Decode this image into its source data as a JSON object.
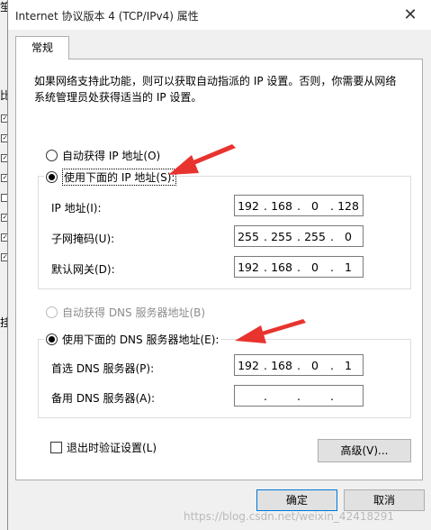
{
  "window": {
    "title": "Internet 协议版本 4 (TCP/IPv4) 属性",
    "close_glyph": "✕"
  },
  "background_window": {
    "chars": [
      "笙",
      "比",
      "挂"
    ],
    "checkbox_glyph": "✓"
  },
  "tab": {
    "label": "常规"
  },
  "description": "如果网络支持此功能，则可以获取自动指派的 IP 设置。否则，你需要从网络系统管理员处获得适当的 IP 设置。",
  "ip_section": {
    "auto_label": "自动获得 IP 地址(O)",
    "manual_label": "使用下面的 IP 地址(S):",
    "selected": "manual",
    "fields": [
      {
        "label": "IP 地址(I):",
        "octets": [
          "192",
          "168",
          "0",
          "128"
        ]
      },
      {
        "label": "子网掩码(U):",
        "octets": [
          "255",
          "255",
          "255",
          "0"
        ]
      },
      {
        "label": "默认网关(D):",
        "octets": [
          "192",
          "168",
          "0",
          "1"
        ]
      }
    ]
  },
  "dns_section": {
    "auto_label": "自动获得 DNS 服务器地址(B)",
    "manual_label": "使用下面的 DNS 服务器地址(E):",
    "selected": "manual",
    "fields": [
      {
        "label": "首选 DNS 服务器(P):",
        "octets": [
          "192",
          "168",
          "0",
          "1"
        ]
      },
      {
        "label": "备用 DNS 服务器(A):",
        "octets": [
          "",
          "",
          "",
          ""
        ]
      }
    ]
  },
  "validate_label": "退出时验证设置(L)",
  "advanced_button": "高级(V)...",
  "ok_button": "确定",
  "cancel_button": "取消",
  "octet_separator": ".",
  "watermark": "https://blog.csdn.net/weixin_42418291",
  "colors": {
    "annotation_arrow": "#e8332f",
    "default_button_border": "#0078d7"
  }
}
